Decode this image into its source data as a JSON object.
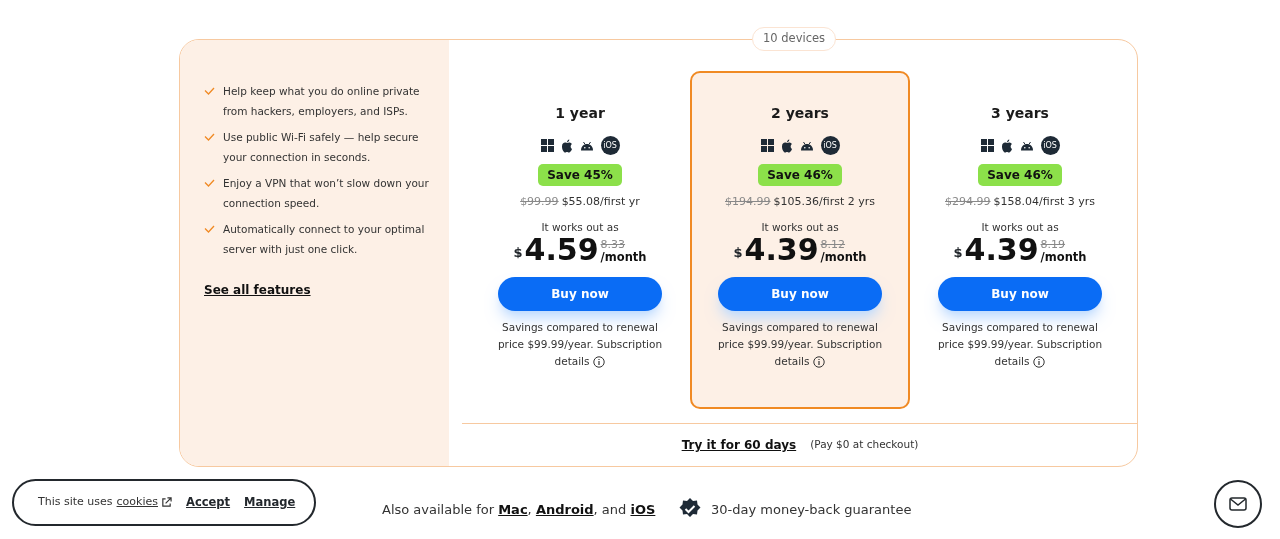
{
  "devices_label": "10 devices",
  "features": [
    "Help keep what you do online private from hackers, employers, and ISPs.",
    "Use public Wi-Fi safely — help secure your connection in seconds.",
    "Enjoy a VPN that won’t slow down your connection speed.",
    "Automatically connect to your optimal server with just one click."
  ],
  "features_link": "See all features",
  "plans": [
    {
      "title": "1 year",
      "selected": false,
      "ios_badge": "iOS",
      "save": "Save 45%",
      "old_price": "$99.99",
      "price": "$55.08/first yr",
      "works_out": "It works out as",
      "currency": "$",
      "monthly": "4.59",
      "old_monthly": "8.33",
      "per": "/month",
      "button": "Buy now",
      "note": "Savings compared to renewal price $99.99/year. Subscription",
      "details": "details"
    },
    {
      "title": "2 years",
      "selected": true,
      "ios_badge": "iOS",
      "save": "Save 46%",
      "old_price": "$194.99",
      "price": "$105.36/first 2 yrs",
      "works_out": "It works out as",
      "currency": "$",
      "monthly": "4.39",
      "old_monthly": "8.12",
      "per": "/month",
      "button": "Buy now",
      "note": "Savings compared to renewal price $99.99/year. Subscription",
      "details": "details"
    },
    {
      "title": "3 years",
      "selected": false,
      "ios_badge": "iOS",
      "save": "Save 46%",
      "old_price": "$294.99",
      "price": "$158.04/first 3 yrs",
      "works_out": "It works out as",
      "currency": "$",
      "monthly": "4.39",
      "old_monthly": "8.19",
      "per": "/month",
      "button": "Buy now",
      "note": "Savings compared to renewal price $99.99/year. Subscription",
      "details": "details"
    }
  ],
  "trial": {
    "link": "Try it for 60 days",
    "note": "(Pay $0 at checkout)"
  },
  "cookie_banner": {
    "text": "This site uses",
    "link": "cookies",
    "accept": "Accept",
    "manage": "Manage"
  },
  "availability": [
    {
      "kind": "text",
      "text": "Also available for "
    },
    {
      "kind": "link",
      "text": "Mac"
    },
    {
      "kind": "text",
      "text": ", "
    },
    {
      "kind": "link",
      "text": "Android"
    },
    {
      "kind": "text",
      "text": ", and "
    },
    {
      "kind": "link",
      "text": "iOS"
    }
  ],
  "guarantee": "30-day money-back guarantee"
}
